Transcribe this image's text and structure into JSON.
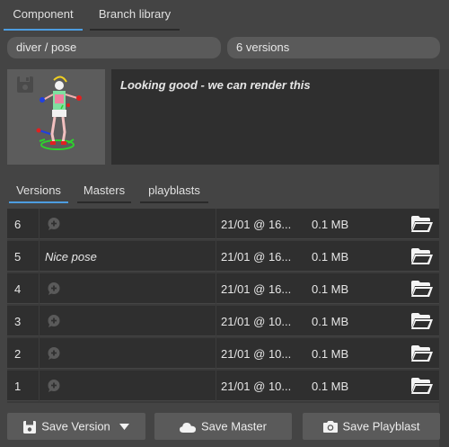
{
  "tabs": {
    "component": "Component",
    "branch_library": "Branch library"
  },
  "path": "diver / pose",
  "versions_count": "6 versions",
  "comment": "Looking good - we can render this",
  "subtabs": {
    "versions": "Versions",
    "masters": "Masters",
    "playblasts": "playblasts"
  },
  "rows": [
    {
      "num": "6",
      "note": "",
      "date": "21/01 @ 16...",
      "size": "0.1 MB"
    },
    {
      "num": "5",
      "note": "Nice pose",
      "date": "21/01 @ 16...",
      "size": "0.1 MB"
    },
    {
      "num": "4",
      "note": "",
      "date": "21/01 @ 16...",
      "size": "0.1 MB"
    },
    {
      "num": "3",
      "note": "",
      "date": "21/01 @ 10...",
      "size": "0.1 MB"
    },
    {
      "num": "2",
      "note": "",
      "date": "21/01 @ 10...",
      "size": "0.1 MB"
    },
    {
      "num": "1",
      "note": "",
      "date": "21/01 @ 10...",
      "size": "0.1 MB"
    }
  ],
  "buttons": {
    "save_version": "Save Version",
    "save_master": "Save Master",
    "save_playblast": "Save Playblast"
  },
  "colors": {
    "accent": "#4d9de0",
    "panel": "#2f2f2f",
    "background": "#444444"
  }
}
